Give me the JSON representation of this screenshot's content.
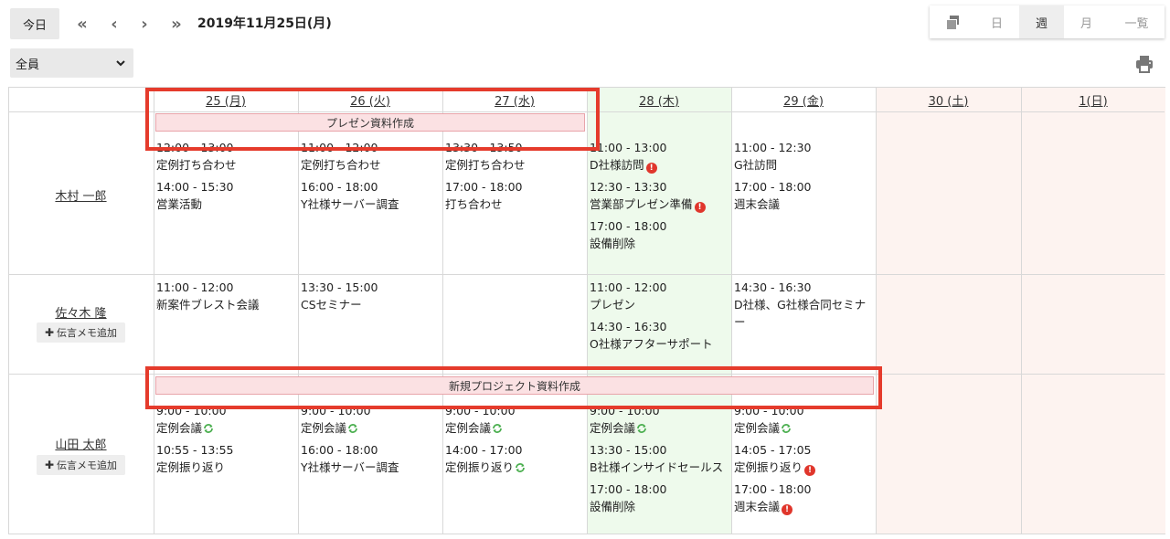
{
  "toolbar": {
    "today_label": "今日",
    "current_date": "2019年11月25日(月)",
    "member_filter": "全員",
    "views": {
      "day": "日",
      "week": "週",
      "month": "月",
      "list": "一覧"
    },
    "active_view": "週"
  },
  "days": [
    "25 (月)",
    "26 (火)",
    "27 (水)",
    "28 (木)",
    "29 (金)",
    "30 (土)",
    "1(日)"
  ],
  "colors": {
    "today_bg": "#eefaec",
    "weekend_bg": "#fdf3f0",
    "banner_bg": "#fbe1e3",
    "highlight": "#e53b2c",
    "alert": "#e0362c",
    "repeat": "#4caf50"
  },
  "memo_label": "伝言メモ追加",
  "members": [
    {
      "name": "木村 一郎",
      "banner": "プレゼン資料作成",
      "events": [
        [
          {
            "time": "12:00 - 13:00",
            "title": "定例打ち合わせ"
          },
          {
            "time": "14:00 - 15:30",
            "title": "営業活動"
          }
        ],
        [
          {
            "time": "11:00 - 12:00",
            "title": "定例打ち合わせ"
          },
          {
            "time": "16:00 - 18:00",
            "title": "Y社様サーバー調査"
          }
        ],
        [
          {
            "time": "13:30 - 13:50",
            "title": "定例打ち合わせ"
          },
          {
            "time": "17:00 - 18:00",
            "title": "打ち合わせ"
          }
        ],
        [
          {
            "time": "11:00 - 13:00",
            "title": "D社様訪問",
            "alert": true
          },
          {
            "time": "12:30 - 13:30",
            "title": "営業部プレゼン準備",
            "alert": true
          },
          {
            "time": "17:00 - 18:00",
            "title": "設備削除"
          }
        ],
        [
          {
            "time": "11:00 - 12:30",
            "title": "G社訪問"
          },
          {
            "time": "17:00 - 18:00",
            "title": "週末会議"
          }
        ],
        [],
        []
      ]
    },
    {
      "name": "佐々木 隆",
      "events": [
        [
          {
            "time": "11:00 - 12:00",
            "title": "新案件ブレスト会議"
          }
        ],
        [
          {
            "time": "13:30 - 15:00",
            "title": "CSセミナー"
          }
        ],
        [],
        [
          {
            "time": "11:00 - 12:00",
            "title": "プレゼン"
          },
          {
            "time": "14:30 - 16:30",
            "title": "O社様アフターサポート"
          }
        ],
        [
          {
            "time": "14:30 - 16:30",
            "title": "D社様、G社様合同セミナー",
            "wrap": true
          }
        ],
        [],
        []
      ]
    },
    {
      "name": "山田 太郎",
      "banner": "新規プロジェクト資料作成",
      "events": [
        [
          {
            "time": "9:00 - 10:00",
            "title": "定例会議",
            "repeat": true
          },
          {
            "time": "10:55 - 13:55",
            "title": "定例振り返り"
          }
        ],
        [
          {
            "time": "9:00 - 10:00",
            "title": "定例会議",
            "repeat": true
          },
          {
            "time": "16:00 - 18:00",
            "title": "Y社様サーバー調査"
          }
        ],
        [
          {
            "time": "9:00 - 10:00",
            "title": "定例会議",
            "repeat": true
          },
          {
            "time": "14:00 - 17:00",
            "title": "定例振り返り",
            "repeat": true
          }
        ],
        [
          {
            "time": "9:00 - 10:00",
            "title": "定例会議",
            "repeat": true
          },
          {
            "time": "13:30 - 15:00",
            "title": "B社様インサイドセールス"
          },
          {
            "time": "17:00 - 18:00",
            "title": "設備削除"
          }
        ],
        [
          {
            "time": "9:00 - 10:00",
            "title": "定例会議",
            "repeat": true
          },
          {
            "time": "14:05 - 17:05",
            "title": "定例振り返り",
            "alert": true
          },
          {
            "time": "17:00 - 18:00",
            "title": "週末会議",
            "alert": true
          }
        ],
        [],
        []
      ]
    }
  ]
}
